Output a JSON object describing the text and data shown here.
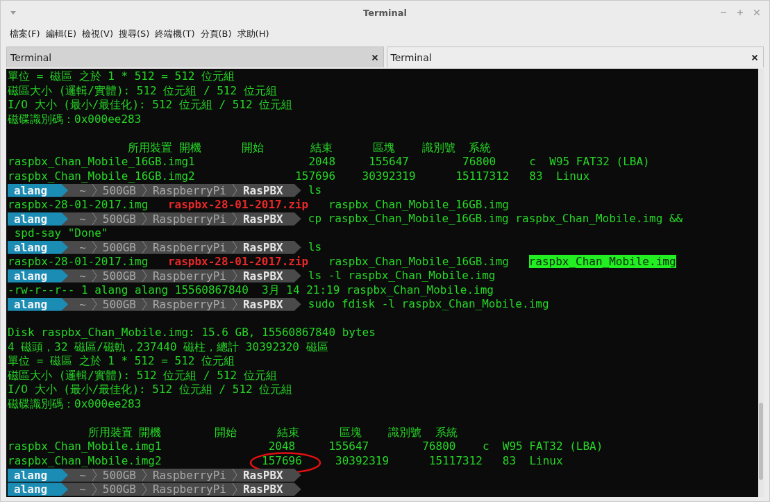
{
  "window": {
    "title": "Terminal"
  },
  "menu": [
    "檔案(F)",
    "編輯(E)",
    "檢視(V)",
    "搜尋(S)",
    "終端機(T)",
    "分頁(B)",
    "求助(H)"
  ],
  "tabs": [
    {
      "label": "Terminal",
      "selected": false
    },
    {
      "label": "Terminal",
      "selected": true
    }
  ],
  "terminal": {
    "lines": [
      {
        "kind": "output",
        "segments": [
          {
            "text": "單位 = 磁區 之於 1 * 512 = 512 位元組",
            "kind": "plain"
          }
        ]
      },
      {
        "kind": "output",
        "segments": [
          {
            "text": "磁區大小 (邏輯/實體): 512 位元組 / 512 位元組",
            "kind": "plain"
          }
        ]
      },
      {
        "kind": "output",
        "segments": [
          {
            "text": "I/O 大小 (最小/最佳化): 512 位元組 / 512 位元組",
            "kind": "plain"
          }
        ]
      },
      {
        "kind": "output",
        "segments": [
          {
            "text": "磁碟識別碼：0x000ee283",
            "kind": "plain"
          }
        ]
      },
      {
        "kind": "blank"
      },
      {
        "kind": "output",
        "segments": [
          {
            "text": "                  所用裝置 開機      開始       結束      區塊    識別號  系統",
            "kind": "plain"
          }
        ]
      },
      {
        "kind": "output",
        "segments": [
          {
            "text": "raspbx_Chan_Mobile_16GB.img1                 2048     155647        76800     c  W95 FAT32 (LBA)",
            "kind": "plain"
          }
        ]
      },
      {
        "kind": "output",
        "segments": [
          {
            "text": "raspbx_Chan_Mobile_16GB.img2               157696    30392319      15117312   83  Linux",
            "kind": "plain"
          }
        ]
      },
      {
        "kind": "prompt",
        "user": "alang",
        "path": [
          "~",
          "500GB",
          "RaspberryPi",
          "RasPBX"
        ],
        "command": "ls"
      },
      {
        "kind": "output",
        "segments": [
          {
            "text": "raspbx-28-01-2017.img",
            "kind": "plain"
          },
          {
            "text": "raspbx-28-01-2017.zip",
            "kind": "archive"
          },
          {
            "text": "raspbx_Chan_Mobile_16GB.img",
            "kind": "plain"
          }
        ]
      },
      {
        "kind": "prompt",
        "user": "alang",
        "path": [
          "~",
          "500GB",
          "RaspberryPi",
          "RasPBX"
        ],
        "command": "cp raspbx_Chan_Mobile_16GB.img raspbx_Chan_Mobile.img &&"
      },
      {
        "kind": "output",
        "segments": [
          {
            "text": " spd-say \"Done\"",
            "kind": "plain"
          }
        ]
      },
      {
        "kind": "prompt",
        "user": "alang",
        "path": [
          "~",
          "500GB",
          "RaspberryPi",
          "RasPBX"
        ],
        "command": "ls"
      },
      {
        "kind": "output",
        "segments": [
          {
            "text": "raspbx-28-01-2017.img",
            "kind": "plain"
          },
          {
            "text": "raspbx-28-01-2017.zip",
            "kind": "archive"
          },
          {
            "text": "raspbx_Chan_Mobile_16GB.img",
            "kind": "plain"
          },
          {
            "text": "raspbx_Chan_Mobile.img",
            "kind": "highlight"
          }
        ]
      },
      {
        "kind": "prompt",
        "user": "alang",
        "path": [
          "~",
          "500GB",
          "RaspberryPi",
          "RasPBX"
        ],
        "command": "ls -l raspbx_Chan_Mobile.img"
      },
      {
        "kind": "output",
        "segments": [
          {
            "text": "-rw-r--r-- 1 alang alang 15560867840  3月 14 21:19 raspbx_Chan_Mobile.img",
            "kind": "plain"
          }
        ]
      },
      {
        "kind": "prompt",
        "user": "alang",
        "path": [
          "~",
          "500GB",
          "RaspberryPi",
          "RasPBX"
        ],
        "command": "sudo fdisk -l raspbx_Chan_Mobile.img"
      },
      {
        "kind": "blank"
      },
      {
        "kind": "output",
        "segments": [
          {
            "text": "Disk raspbx_Chan_Mobile.img: 15.6 GB, 15560867840 bytes",
            "kind": "plain"
          }
        ]
      },
      {
        "kind": "output",
        "segments": [
          {
            "text": "4 磁頭，32 磁區/磁軌，237440 磁柱，總計 30392320 磁區",
            "kind": "plain"
          }
        ]
      },
      {
        "kind": "output",
        "segments": [
          {
            "text": "單位 = 磁區 之於 1 * 512 = 512 位元組",
            "kind": "plain"
          }
        ]
      },
      {
        "kind": "output",
        "segments": [
          {
            "text": "磁區大小 (邏輯/實體): 512 位元組 / 512 位元組",
            "kind": "plain"
          }
        ]
      },
      {
        "kind": "output",
        "segments": [
          {
            "text": "I/O 大小 (最小/最佳化): 512 位元組 / 512 位元組",
            "kind": "plain"
          }
        ]
      },
      {
        "kind": "output",
        "segments": [
          {
            "text": "磁碟識別碼：0x000ee283",
            "kind": "plain"
          }
        ]
      },
      {
        "kind": "blank"
      },
      {
        "kind": "output",
        "segments": [
          {
            "text": "            所用裝置 開機        開始      結束      區塊    識別號  系統",
            "kind": "plain"
          }
        ]
      },
      {
        "kind": "output",
        "segments": [
          {
            "text": "raspbx_Chan_Mobile.img1                2048     155647        76800    c  W95 FAT32 (LBA)",
            "kind": "plain"
          }
        ]
      },
      {
        "kind": "output",
        "segments": [
          {
            "text": "raspbx_Chan_Mobile.img2              ",
            "kind": "plain"
          },
          {
            "text": "157696",
            "kind": "plain",
            "circled": true
          },
          {
            "text": "    30392319      15117312   83  Linux",
            "kind": "plain"
          }
        ]
      },
      {
        "kind": "prompt",
        "user": "alang",
        "path": [
          "~",
          "500GB",
          "RaspberryPi",
          "RasPBX"
        ]
      },
      {
        "kind": "prompt",
        "user": "alang",
        "path": [
          "~",
          "500GB",
          "RaspberryPi",
          "RasPBX"
        ]
      }
    ]
  }
}
